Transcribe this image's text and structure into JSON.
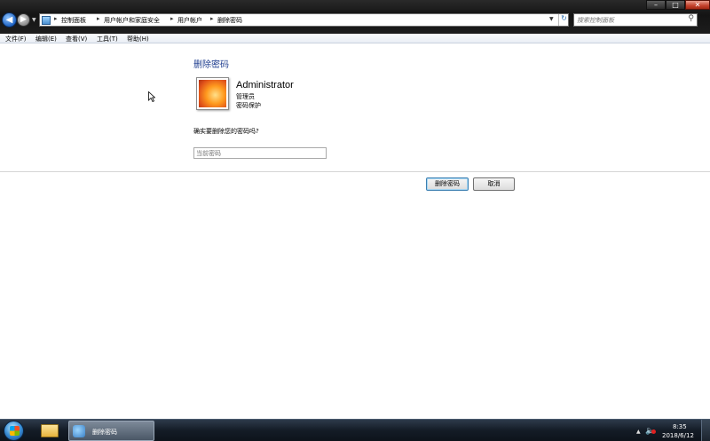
{
  "window": {
    "breadcrumbs": [
      "控制面板",
      "用户帐户和家庭安全",
      "用户帐户",
      "删除密码"
    ],
    "search_placeholder": "搜索控制面板"
  },
  "menu": [
    "文件(F)",
    "编辑(E)",
    "查看(V)",
    "工具(T)",
    "帮助(H)"
  ],
  "main": {
    "title": "删除密码",
    "user": {
      "name": "Administrator",
      "role": "管理员",
      "status": "密码保护"
    },
    "confirm_text": "确实要删除您的密码吗?",
    "password_placeholder": "当前密码",
    "delete_button": "删除密码",
    "cancel_button": "取消"
  },
  "taskbar": {
    "active_window": "删除密码",
    "time": "8:35",
    "date": "2018/6/12"
  },
  "icons": {
    "back": "back-arrow-icon",
    "forward": "forward-arrow-icon",
    "search": "search-icon",
    "refresh": "refresh-icon"
  }
}
